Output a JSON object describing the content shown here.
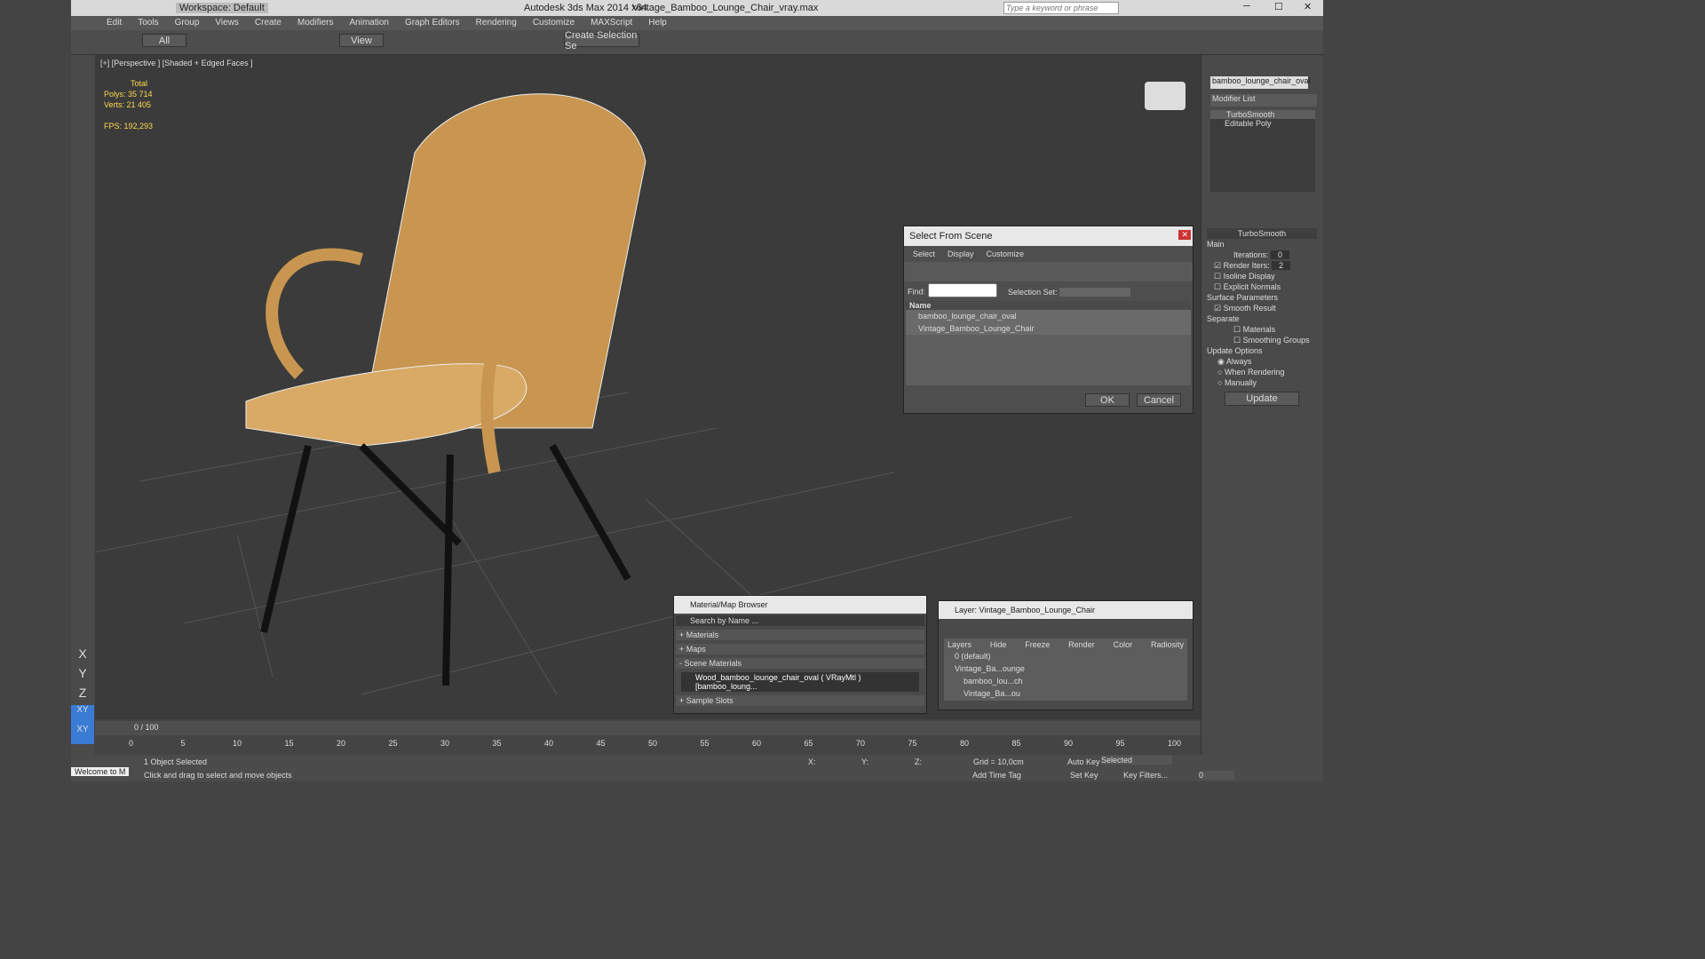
{
  "titlebar": {
    "workspace": "Workspace: Default",
    "app": "Autodesk 3ds Max  2014 x64",
    "file": "Vintage_Bamboo_Lounge_Chair_vray.max",
    "search_placeholder": "Type a keyword or phrase"
  },
  "menu": [
    "Edit",
    "Tools",
    "Group",
    "Views",
    "Create",
    "Modifiers",
    "Animation",
    "Graph Editors",
    "Rendering",
    "Customize",
    "MAXScript",
    "Help"
  ],
  "toolbar": {
    "filter": "All",
    "view": "View",
    "selset": "Create Selection Se"
  },
  "viewport": {
    "label": "[+] [Perspective ] [Shaded + Edged Faces ]",
    "total": "Total",
    "polys_l": "Polys:",
    "polys": "35 714",
    "verts_l": "Verts:",
    "verts": "21 405",
    "fps_l": "FPS:",
    "fps": "192,293"
  },
  "cmd": {
    "objname": "bamboo_lounge_chair_oval",
    "modlist": "Modifier List",
    "stack": [
      "TurboSmooth",
      "Editable Poly"
    ],
    "rollout": "TurboSmooth",
    "main": "Main",
    "iter_l": "Iterations:",
    "iter": "0",
    "render_l": "Render Iters:",
    "render": "2",
    "isoline": "Isoline Display",
    "explicit": "Explicit Normals",
    "surf": "Surface Parameters",
    "smooth": "Smooth Result",
    "separate": "Separate",
    "mats": "Materials",
    "sgroups": "Smoothing Groups",
    "upd": "Update Options",
    "always": "Always",
    "whenr": "When Rendering",
    "manually": "Manually",
    "update": "Update"
  },
  "sfs": {
    "title": "Select From Scene",
    "menu": [
      "Select",
      "Display",
      "Customize"
    ],
    "find": "Find:",
    "selset": "Selection Set:",
    "col": "Name",
    "items": [
      "bamboo_lounge_chair_oval",
      "Vintage_Bamboo_Lounge_Chair"
    ],
    "ok": "OK",
    "cancel": "Cancel"
  },
  "mb": {
    "title": "Material/Map Browser",
    "search": "Search by Name ...",
    "rows": [
      "+ Materials",
      "+ Maps",
      "- Scene Materials",
      "+ Sample Slots"
    ],
    "mat": "Wood_bamboo_lounge_chair_oval ( VRayMtl ) [bamboo_loung..."
  },
  "layer": {
    "title": "Layer: Vintage_Bamboo_Lounge_Chair",
    "cols": [
      "Layers",
      "Hide",
      "Freeze",
      "Render",
      "Color",
      "Radiosity"
    ],
    "rows": [
      "0 (default)",
      "Vintage_Ba...ounge",
      "bamboo_lou...ch",
      "Vintage_Ba...ou"
    ]
  },
  "timeline": {
    "frame": "0 / 100",
    "ticks": [
      "0",
      "5",
      "10",
      "15",
      "20",
      "25",
      "30",
      "35",
      "40",
      "45",
      "50",
      "55",
      "60",
      "65",
      "70",
      "75",
      "80",
      "85",
      "90",
      "95",
      "100"
    ]
  },
  "status": {
    "sel": "1 Object Selected",
    "hint": "Click and drag to select and move objects",
    "welcome": "Welcome to M",
    "x": "X:",
    "y": "Y:",
    "z": "Z:",
    "grid": "Grid = 10,0cm",
    "autokey": "Auto Key",
    "selected": "Selected",
    "setkey": "Set Key",
    "keyf": "Key Filters...",
    "addtime": "Add Time Tag",
    "frame": "0"
  },
  "axes": [
    "X",
    "Y",
    "Z",
    "XY",
    "XY"
  ]
}
